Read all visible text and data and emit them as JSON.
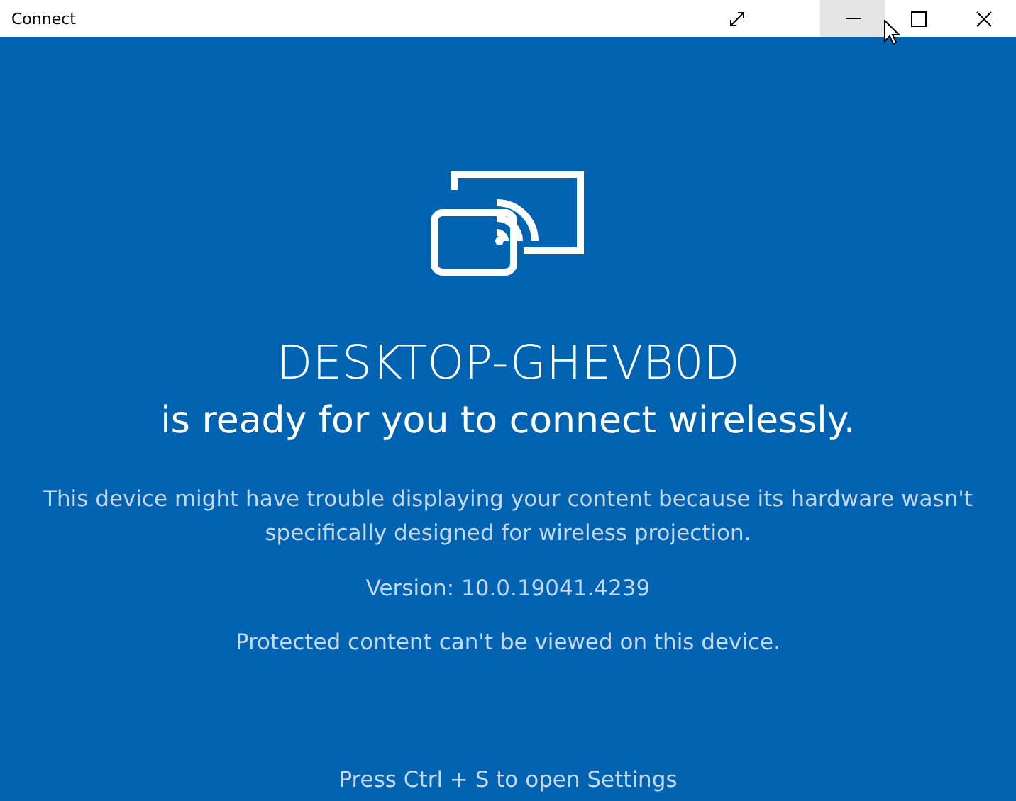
{
  "window": {
    "title": "Connect",
    "buttons": [
      {
        "kind": "fullscreen",
        "hovered": false
      },
      {
        "kind": "minimize",
        "hovered": true
      },
      {
        "kind": "maximize",
        "hovered": false
      },
      {
        "kind": "close",
        "hovered": false
      }
    ]
  },
  "main": {
    "device_name": "DESKTOP-GHEVB0D",
    "headline": "is ready for you to connect wirelessly.",
    "warning": "This device might have trouble displaying your content because its hardware wasn't specifically designed for wireless projection.",
    "version": "Version: 10.0.19041.4239",
    "protected_note": "Protected content can't be viewed on this device.",
    "hint": "Press Ctrl + S to open Settings"
  }
}
